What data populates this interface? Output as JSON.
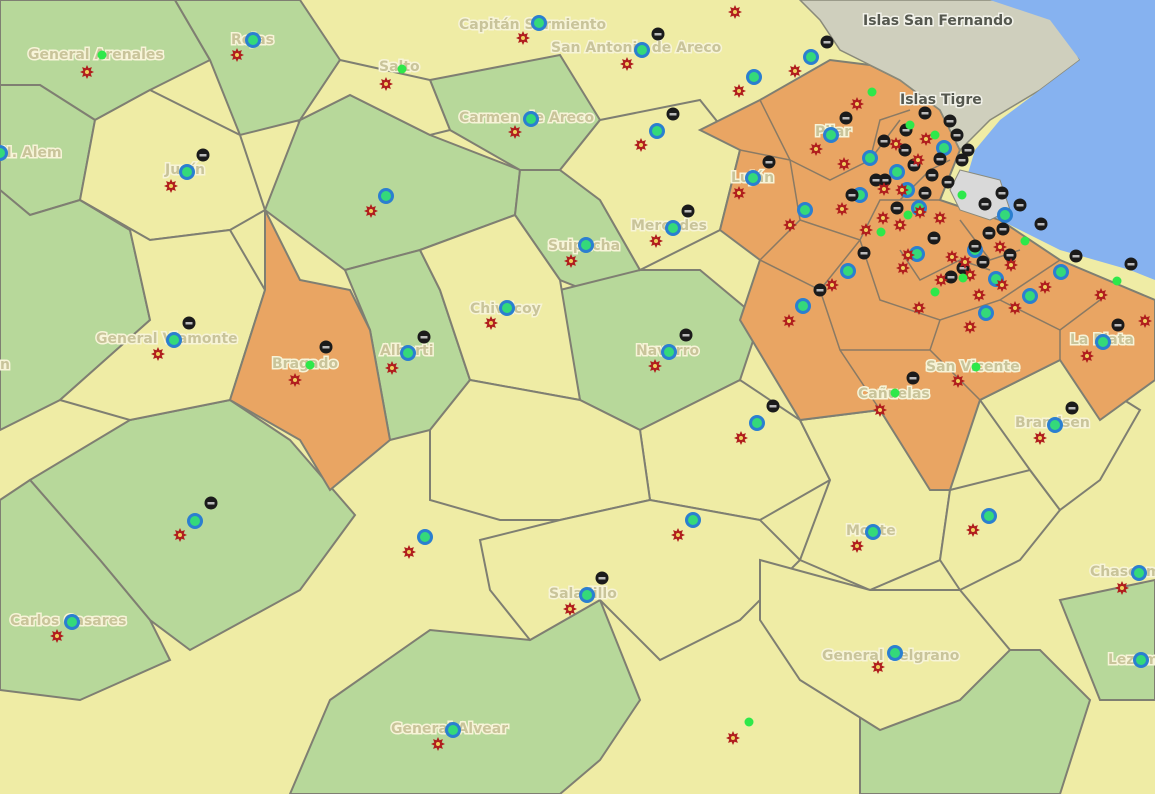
{
  "map": {
    "colors": {
      "green": "#b7d89a",
      "yellow": "#efeca5",
      "orange": "#e9a563",
      "water": "#86b2f0",
      "delta": "#cfcfbd",
      "border": "#7f7f72"
    },
    "labels": {
      "general_arenales": "General Arenales",
      "rojas": "Rojas",
      "salto": "Salto",
      "capitan_sarmiento": "Capitán Sarmiento",
      "san_antonio_de_areco": "San Antonio de Areco",
      "islas_san_fernando": "Islas San Fernando",
      "islas_tigre": "Islas Tigre",
      "carmen_de_areco": "Carmen de Areco",
      "n_alem": "N. Alem",
      "junin": "Junín",
      "pilar": "Pilar",
      "lujan": "Luján",
      "mercedes": "Mercedes",
      "suipacha": "Suipacha",
      "chivilcoy": "Chivilcoy",
      "general_viamonte": "General Viamonte",
      "bragado": "Bragado",
      "alberti": "Alberti",
      "navarro": "Navarro",
      "la_plata": "La Plata",
      "san_vicente": "San Vicente",
      "canuelas": "Cañuelas",
      "brandsen": "Brandsen",
      "monte": "Monte",
      "chascomus": "Chascomús",
      "saladillo": "Saladillo",
      "carlos_casares": "Carlos Casares",
      "general_belgrano": "General Belgrano",
      "general_alvear": "General Alvear",
      "lezama": "Lezama",
      "edge_n": "n"
    },
    "marker_legend": [
      "blue-ring-icon",
      "black-sign-icon",
      "red-star-icon",
      "green-dot-icon"
    ]
  }
}
